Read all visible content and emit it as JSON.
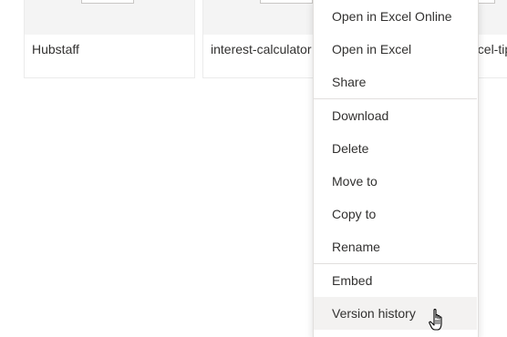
{
  "tiles": [
    {
      "name": "Hubstaff"
    },
    {
      "name": "interest-calculator"
    },
    {
      "name": "excel-tips"
    }
  ],
  "context_menu": {
    "items": [
      {
        "label": "Open in Excel Online"
      },
      {
        "label": "Open in Excel"
      },
      {
        "label": "Share"
      },
      {
        "label": "Download"
      },
      {
        "label": "Delete"
      },
      {
        "label": "Move to"
      },
      {
        "label": "Copy to"
      },
      {
        "label": "Rename"
      },
      {
        "label": "Embed"
      },
      {
        "label": "Version history"
      }
    ],
    "hovered_item": "Version history"
  },
  "cursor": {
    "icon": "hand-pointer-icon"
  }
}
